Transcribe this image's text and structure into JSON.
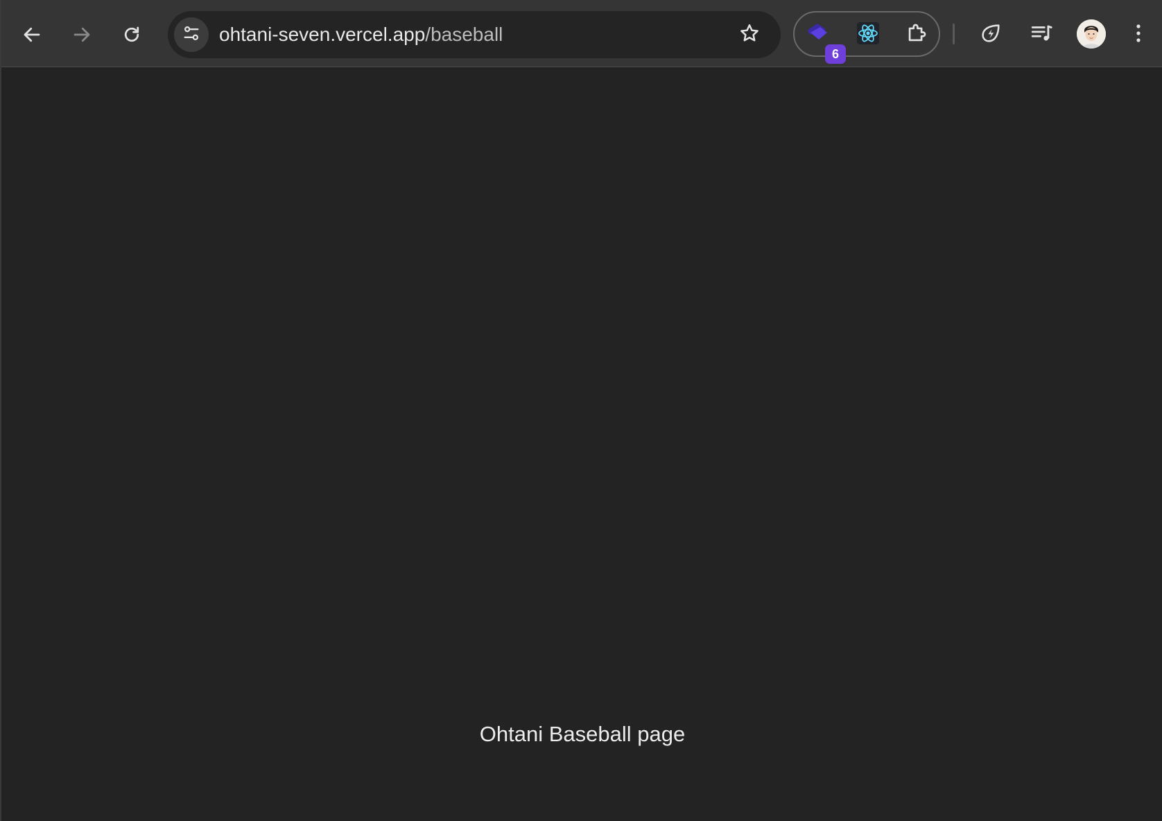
{
  "browser": {
    "url": {
      "host": "ohtani-seven.vercel.app",
      "path": "/baseball"
    },
    "extensions": {
      "badge_count": "6"
    },
    "icons": {
      "back": "back-arrow-icon",
      "forward": "forward-arrow-icon",
      "reload": "reload-icon",
      "site_info": "tune-icon",
      "bookmark": "star-icon",
      "extension_1": "purple-extension-icon",
      "extension_2": "react-icon",
      "extensions_menu": "puzzle-icon",
      "performance": "lightning-leaf-icon",
      "media": "playlist-music-icon",
      "profile": "avatar",
      "menu": "kebab-menu-icon"
    },
    "colors": {
      "toolbar": "#353535",
      "omnibox": "#242424",
      "page_background": "#232323",
      "badge": "#6f3fdc",
      "react": "#61dafb"
    }
  },
  "page": {
    "label": "Ohtani Baseball page"
  }
}
